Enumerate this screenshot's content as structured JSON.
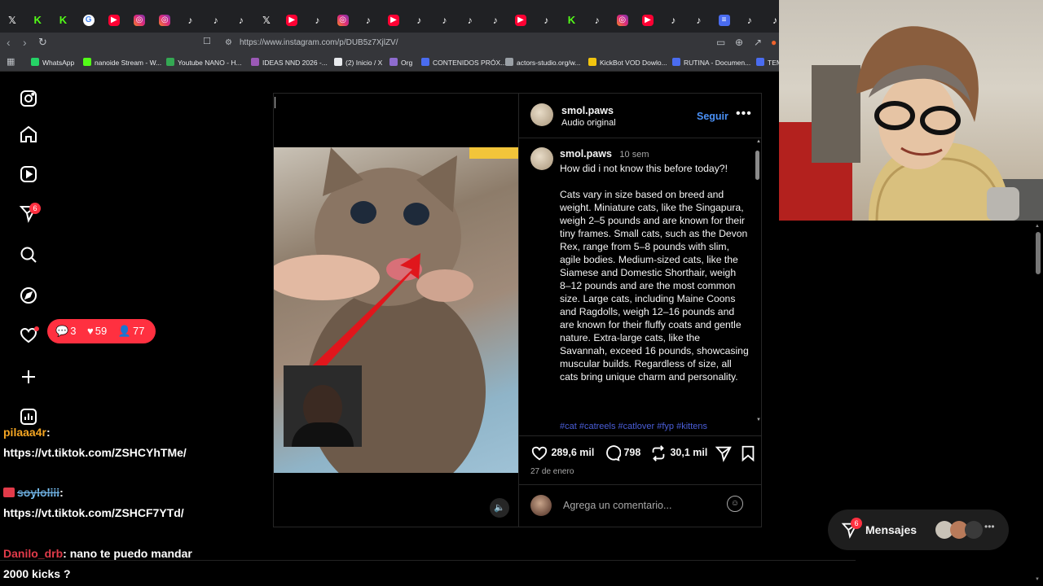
{
  "browser": {
    "url": "https://www.instagram.com/p/DUB5z7XjlZV/",
    "tab_icons": [
      "x-icon",
      "kick-icon",
      "kick-icon",
      "google-icon",
      "youtube-icon",
      "instagram-icon",
      "instagram-icon",
      "tiktok-icon",
      "tiktok-icon",
      "tiktok-icon",
      "x-icon",
      "youtube-icon",
      "tiktok-icon",
      "instagram-icon",
      "tiktok-icon",
      "youtube-icon",
      "tiktok-icon",
      "tiktok-icon",
      "tiktok-icon",
      "tiktok-icon",
      "youtube-icon",
      "tiktok-icon",
      "kick-icon",
      "tiktok-icon",
      "instagram-icon",
      "youtube-icon",
      "tiktok-icon",
      "tiktok-icon",
      "doc-icon",
      "tiktok-icon",
      "tiktok-icon"
    ],
    "bookmarks": [
      {
        "label": "WhatsApp",
        "color": "#25d366"
      },
      {
        "label": "nanoide Stream - W...",
        "color": "#53fc18"
      },
      {
        "label": "Youtube NANO - H...",
        "color": "#34a853"
      },
      {
        "label": "IDEAS NND 2026 -...",
        "color": "#9b59b6"
      },
      {
        "label": "(2) Inicio / X",
        "color": "#e8eaed"
      },
      {
        "label": "Org",
        "color": "#8e6ccf"
      },
      {
        "label": "CONTENIDOS PRÓX...",
        "color": "#4a6cf0"
      },
      {
        "label": "actors-studio.org/w...",
        "color": "#9aa0a6"
      },
      {
        "label": "KickBot VOD Dowlo...",
        "color": "#f1c40f"
      },
      {
        "label": "RUTINA - Documen...",
        "color": "#4a6cf0"
      },
      {
        "label": "TEM",
        "color": "#4a6cf0"
      }
    ]
  },
  "sidebar": {
    "notifications_badge": "6"
  },
  "notification_pill": {
    "comments": "3",
    "likes": "59",
    "follows": "77"
  },
  "post": {
    "username": "smol.paws",
    "audio": "Audio original",
    "follow_label": "Seguir",
    "caption_user": "smol.paws",
    "caption_time": "10 sem",
    "caption_first": "How did i not know this before today?!",
    "caption_body": "Cats vary in size based on breed and weight. Miniature cats, like the Singapura, weigh 2–5 pounds and are known for their tiny frames. Small cats, such as the Devon Rex, range from 5–8 pounds with slim, agile bodies. Medium-sized cats, like the Siamese and Domestic Shorthair, weigh 8–12 pounds and are the most common size. Large cats, including Maine Coons and Ragdolls, weigh 12–16 pounds and are known for their fluffy coats and gentle nature. Extra-large cats, like the Savannah, exceed 16 pounds, showcasing muscular builds. Regardless of size, all cats bring unique charm and personality.",
    "hashtags": "#cat #catreels #catlover #fyp #kittens",
    "likes": "289,6 mil",
    "comments": "798",
    "reposts": "30,1 mil",
    "date": "27 de enero",
    "comment_placeholder": "Agrega un comentario..."
  },
  "chat": [
    {
      "user": "pilaaa4r",
      "message": "https://vt.tiktok.com/ZSHCYhTMe/"
    },
    {
      "user": "soyloliii",
      "message": "https://vt.tiktok.com/ZSHCF7YTd/"
    },
    {
      "user": "Danilo_drb",
      "message": "nano te puedo mandar 2000 kicks ?"
    }
  ],
  "messages": {
    "label": "Mensajes",
    "badge": "6"
  }
}
